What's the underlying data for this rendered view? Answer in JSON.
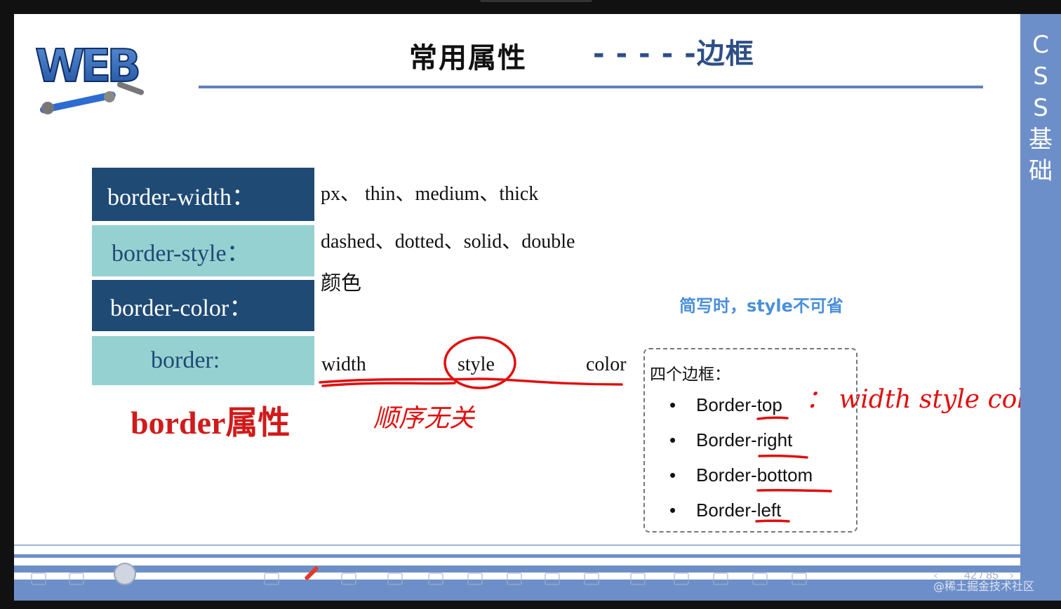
{
  "slide": {
    "logo_text": "WEB",
    "title": "常用属性",
    "subtitle": "- - - - -边框",
    "sidebar_text": "C\nS\nS\n基\n础"
  },
  "properties": [
    {
      "label": "border-width：",
      "value": "px、 thin、medium、thick"
    },
    {
      "label": "border-style：",
      "value": "dashed、dotted、solid、double"
    },
    {
      "label": "border-color：",
      "value": "颜色"
    },
    {
      "label": "border:",
      "value": ""
    }
  ],
  "shorthand": {
    "parts": [
      "width",
      "style",
      "color"
    ],
    "note": "简写时，style不可省",
    "red_label": "border属性",
    "handwritten_order": "顺序无关"
  },
  "sides_box": {
    "title": "四个边框：",
    "items": [
      "Border-top",
      "Border-right",
      "Border-bottom",
      "Border-left"
    ],
    "handwritten_note": "： width style color"
  },
  "toolbar": {
    "page_counter": "42 / 85"
  },
  "watermark": "@稀土掘金技术社区",
  "colors": {
    "dark_cell": "#1f4a74",
    "light_cell": "#96d1d1",
    "accent_blue": "#5f80bd",
    "sidebar": "#6d8fc9",
    "ink_red": "#e01010",
    "note_blue": "#4a90d9"
  },
  "icons": [
    "menu-icon",
    "screenshot-icon",
    "avatar",
    "pointer-icon",
    "pen-icon",
    "eraser-icon",
    "shapes-icon",
    "zoom-icon",
    "screen-icon",
    "scissors-icon",
    "record-icon",
    "undo-icon",
    "more-icon",
    "palette-icon",
    "notes-icon",
    "present-icon",
    "lock-icon",
    "prev-icon",
    "next-icon"
  ]
}
